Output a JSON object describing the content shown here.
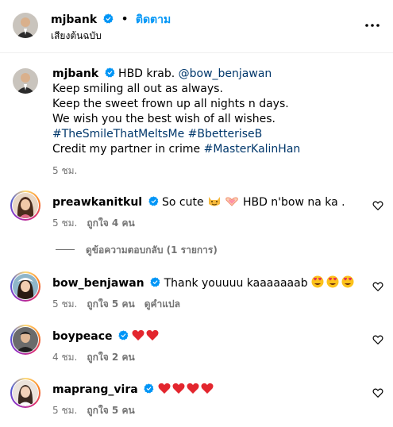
{
  "header": {
    "username": "mjbank",
    "dot": "•",
    "follow_label": "ติดตาม",
    "subtitle": "เสียงต้นฉบับ",
    "more_icon": "more-horizontal-icon"
  },
  "caption": {
    "username": "mjbank",
    "lines": [
      "HBD krab. ",
      "Keep smiling all out as always.",
      "Keep the sweet frown up all nights n days.",
      "We wish you the best wish of all wishes.",
      "#TheSmileThatMeltsMe #BbetteriseB",
      "Credit my partner in crime "
    ],
    "mention": "@bow_benjawan",
    "credit_tag": "#MasterKalinHan",
    "time": "5 ชม."
  },
  "comments": [
    {
      "username": "preawkanitkul",
      "text": "So cute",
      "text2": "HBD n'bow na ka .",
      "time": "5 ชม.",
      "likes": "ถูกใจ 4 คน",
      "translate": ""
    },
    {
      "username": "bow_benjawan",
      "text": "Thank youuuu kaaaaaaab",
      "time": "5 ชม.",
      "likes": "ถูกใจ 5 คน",
      "translate": "ดูคำแปล"
    },
    {
      "username": "boypeace",
      "text": "",
      "time": "4 ชม.",
      "likes": "ถูกใจ 2 คน",
      "translate": ""
    },
    {
      "username": "maprang_vira",
      "text": "",
      "time": "5 ชม.",
      "likes": "ถูกใจ 5 คน",
      "translate": ""
    }
  ],
  "replies_label": "ดูข้อความตอบกลับ (1 รายการ)",
  "colors": {
    "accent": "#0095f6",
    "link": "#00376b",
    "muted": "#737373",
    "verified": "#0095f6",
    "heart": "#ed4956"
  }
}
